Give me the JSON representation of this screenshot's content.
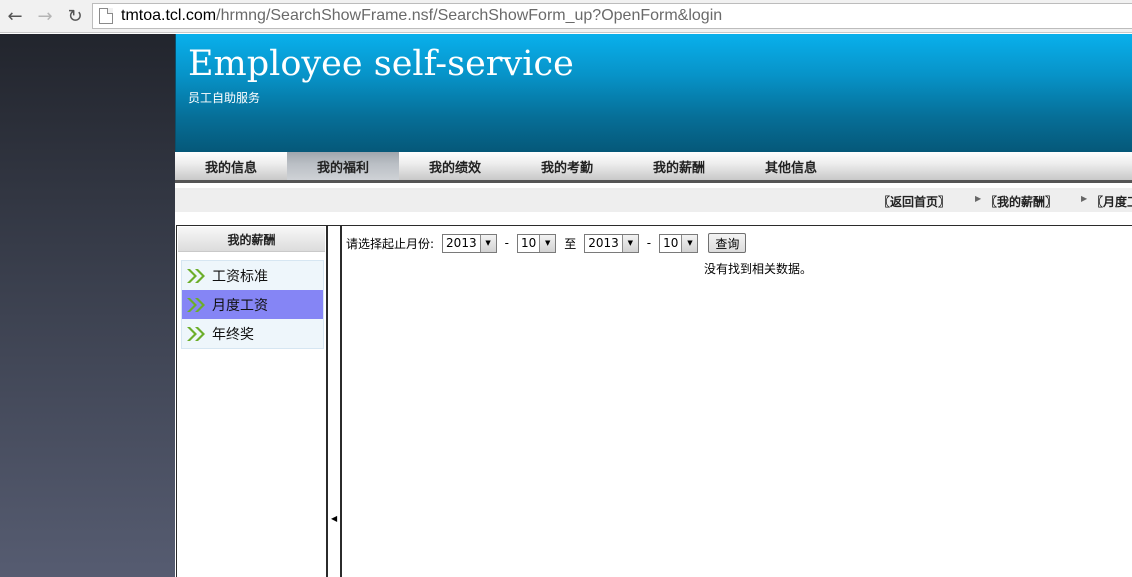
{
  "browser": {
    "url_host": "tmtoa.tcl.com",
    "url_path": "/hrmng/SearchShowFrame.nsf/SearchShowForm_up?OpenForm&login"
  },
  "header": {
    "title": "Employee self-service",
    "subtitle": "员工自助服务"
  },
  "nav": {
    "items": [
      "我的信息",
      "我的福利",
      "我的绩效",
      "我的考勤",
      "我的薪酬",
      "其他信息"
    ],
    "active_index": 1
  },
  "breadcrumb": {
    "home": "〖返回首页〗",
    "section": "〖我的薪酬〗",
    "current": "〖月度工资〗"
  },
  "side_menu": {
    "title": "我的薪酬",
    "items": [
      "工资标准",
      "月度工资",
      "年终奖"
    ],
    "selected_index": 1
  },
  "query": {
    "label": "请选择起止月份:",
    "start_year": "2013",
    "start_month": "10",
    "dash": "-",
    "to": "至",
    "end_year": "2013",
    "end_month": "10",
    "button": "查询",
    "no_data": "没有找到相关数据。"
  },
  "colors": {
    "header_top": "#09b0ec",
    "header_bottom": "#055879",
    "menu_selected": "#8585f5",
    "chevron": "#6cae2a"
  }
}
